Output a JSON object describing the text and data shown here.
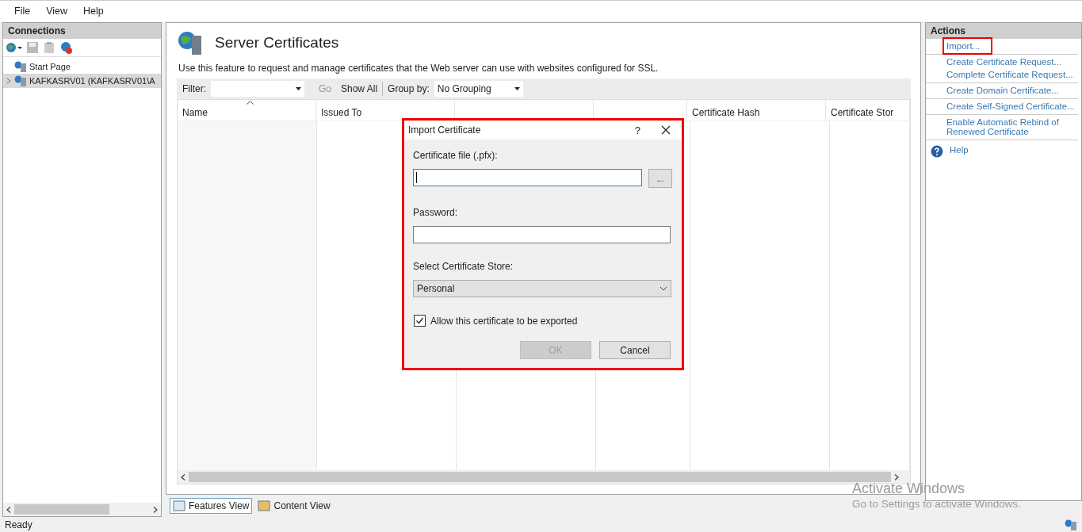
{
  "menu": [
    "File",
    "View",
    "Help"
  ],
  "connections": {
    "title": "Connections",
    "tree": [
      {
        "label": "Start Page",
        "selected": false
      },
      {
        "label": "KAFKASRV01 (KAFKASRV01\\A",
        "selected": true,
        "expanded": false
      }
    ]
  },
  "feature": {
    "title": "Server Certificates",
    "description": "Use this feature to request and manage certificates that the Web server can use with websites configured for SSL.",
    "filter": {
      "label": "Filter:",
      "go": "Go",
      "show_all": "Show All",
      "group_by_label": "Group by:",
      "group_by": "No Grouping"
    },
    "columns": [
      {
        "label": "Name",
        "sorted": true
      },
      {
        "label": "Issued To",
        "sorted": false
      },
      {
        "sorted": false
      },
      {
        "sorted": false
      },
      {
        "label": "Certificate Hash",
        "sorted": false
      },
      {
        "label": "Certificate Stor",
        "sorted": false
      }
    ]
  },
  "views": [
    {
      "label": "Features View",
      "selected": true
    },
    {
      "label": "Content View",
      "selected": false
    }
  ],
  "actions": {
    "title": "Actions",
    "groups": [
      [
        {
          "label": "Import...",
          "highlighted": true
        }
      ],
      [
        {
          "label": "Create Certificate Request...",
          "highlighted": false
        },
        {
          "label": "Complete Certificate Request...",
          "highlighted": false
        }
      ],
      [
        {
          "label": "Create Domain Certificate...",
          "highlighted": false
        }
      ],
      [
        {
          "label": "Create Self-Signed Certificate...",
          "highlighted": false
        }
      ],
      [
        {
          "label": "Enable Automatic Rebind of Renewed Certificate",
          "highlighted": false
        }
      ]
    ],
    "help": "Help"
  },
  "dialog": {
    "title": "Import Certificate",
    "help": "?",
    "highlighted": true,
    "file_label": "Certificate file (.pfx):",
    "browse": "...",
    "password_label": "Password:",
    "store_label": "Select Certificate Store:",
    "store": "Personal",
    "export": {
      "label": "Allow this certificate to be exported",
      "checked": true
    },
    "ok": {
      "label": "OK",
      "disabled": true
    },
    "cancel": {
      "label": "Cancel",
      "disabled": false
    }
  },
  "status_bar": "Ready",
  "watermark": {
    "title": "Activate Windows",
    "subtitle": "Go to Settings to activate Windows."
  }
}
